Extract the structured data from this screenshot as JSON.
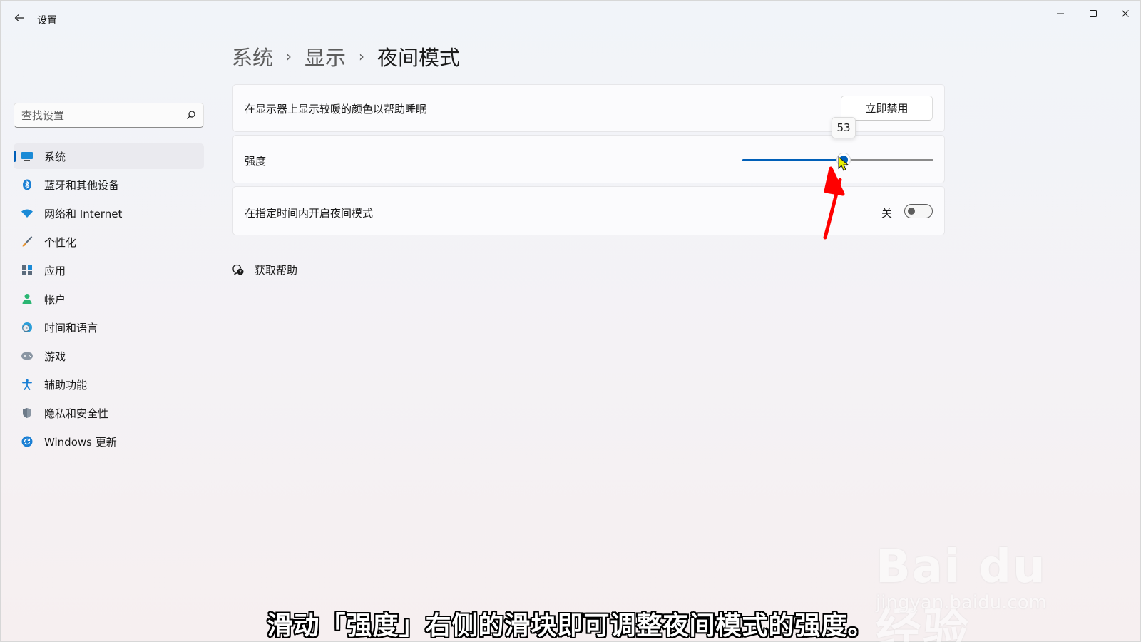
{
  "window": {
    "title": "设置"
  },
  "search": {
    "placeholder": "查找设置"
  },
  "sidebar": {
    "items": [
      {
        "label": "系统",
        "icon": "monitor-icon"
      },
      {
        "label": "蓝牙和其他设备",
        "icon": "bluetooth-icon"
      },
      {
        "label": "网络和 Internet",
        "icon": "wifi-icon"
      },
      {
        "label": "个性化",
        "icon": "brush-icon"
      },
      {
        "label": "应用",
        "icon": "apps-icon"
      },
      {
        "label": "帐户",
        "icon": "account-icon"
      },
      {
        "label": "时间和语言",
        "icon": "clock-globe-icon"
      },
      {
        "label": "游戏",
        "icon": "gamepad-icon"
      },
      {
        "label": "辅助功能",
        "icon": "accessibility-icon"
      },
      {
        "label": "隐私和安全性",
        "icon": "shield-icon"
      },
      {
        "label": "Windows 更新",
        "icon": "update-icon"
      }
    ]
  },
  "breadcrumb": {
    "items": [
      "系统",
      "显示",
      "夜间模式"
    ],
    "separator": "›"
  },
  "cards": {
    "warm": {
      "label": "在显示器上显示较暖的颜色以帮助睡眠",
      "button": "立即禁用"
    },
    "strength": {
      "label": "强度",
      "value": 53,
      "tooltip": "53"
    },
    "schedule": {
      "label": "在指定时间内开启夜间模式",
      "toggle_text": "关"
    }
  },
  "help": {
    "label": "获取帮助"
  },
  "overlay": {
    "subtitle": "滑动「强度」右侧的滑块即可调整夜间模式的强度。",
    "watermark_brand": "Bai du 经验",
    "watermark_site": "jingyan.baidu.com"
  },
  "colors": {
    "accent": "#005fb8",
    "annotation": "#ff0000"
  }
}
